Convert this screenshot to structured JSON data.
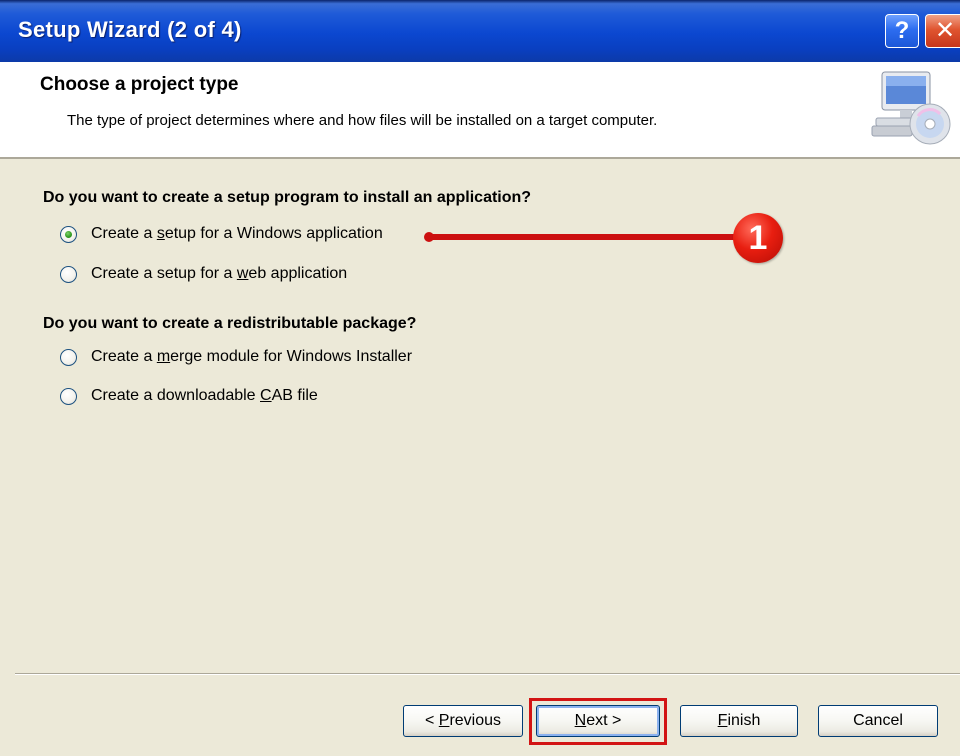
{
  "window": {
    "title": "Setup Wizard (2 of 4)",
    "help_label": "?",
    "close_label": "✕"
  },
  "header": {
    "title": "Choose a project type",
    "description": "The type of project determines where and how files will be installed on a target computer.",
    "icon": "computer-cd-icon"
  },
  "section1": {
    "question": "Do you want to create a setup program to install an application?",
    "options": [
      {
        "pre": "Create a ",
        "key": "s",
        "post": "etup for a Windows application",
        "checked": true
      },
      {
        "pre": "Create a setup for a ",
        "key": "w",
        "post": "eb application",
        "checked": false
      }
    ]
  },
  "section2": {
    "question": "Do you want to create a redistributable package?",
    "options": [
      {
        "pre": "Create a ",
        "key": "m",
        "post": "erge module for Windows Installer",
        "checked": false
      },
      {
        "pre": "Create a downloadable ",
        "key": "C",
        "post": "AB file",
        "checked": false
      }
    ]
  },
  "annotation": {
    "badge": "1",
    "color": "#cc1010"
  },
  "buttons": {
    "previous": {
      "pre": "< ",
      "key": "P",
      "post": "revious"
    },
    "next": {
      "pre": "",
      "key": "N",
      "post": "ext >"
    },
    "finish": {
      "pre": "",
      "key": "F",
      "post": "inish"
    },
    "cancel": {
      "pre": "Cancel",
      "key": "",
      "post": ""
    }
  },
  "colors": {
    "titlebar": "#0b47d0",
    "dialog_bg": "#ece9d8",
    "highlight": "#d21414"
  }
}
